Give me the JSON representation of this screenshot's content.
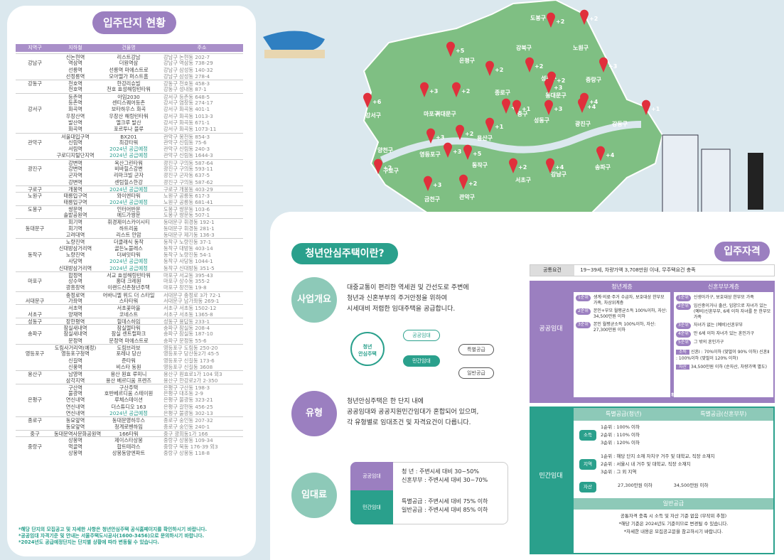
{
  "left": {
    "title": "입주단지 현황",
    "headers": [
      "지역구",
      "지하철",
      "건물명",
      "주소"
    ],
    "rows": [
      [
        "",
        "신논현역",
        "리스트강남",
        "강남구 논현동 202-7",
        1,
        0
      ],
      [
        "강남구",
        "역삼역",
        "더원역삼",
        "강남구 역삼동 738-29",
        0,
        0
      ],
      [
        "",
        "선릉역",
        "선릉역 마에스트로",
        "강남구 삼성동 140-32",
        0,
        0
      ],
      [
        "",
        "선정릉역",
        "모아엘가 퍼스트홈",
        "강남구 삼성동 278-4",
        0,
        0
      ],
      [
        "강동구",
        "천호역",
        "한강리슈빌",
        "강동구 천호동 458-3",
        1,
        0
      ],
      [
        "",
        "천호역",
        "천호 효성해링턴타워",
        "강동구 성내동 87-1",
        0,
        0
      ],
      [
        "",
        "등촌역",
        "아임2030",
        "강서구 등촌동 648-5",
        1,
        0
      ],
      [
        "",
        "등촌역",
        "센티스퀘어등촌",
        "강서구 염창동 274-17",
        0,
        0
      ],
      [
        "강서구",
        "화곡역",
        "보타하우스 화곡",
        "강서구 화곡동 401-1",
        0,
        0
      ],
      [
        "",
        "우장산역",
        "우장산 해링턴타워",
        "강서구 화곡동 1013-3",
        0,
        0
      ],
      [
        "",
        "발산역",
        "엘크루 발산",
        "강서구 화곡동 671-1",
        0,
        0
      ],
      [
        "",
        "화곡역",
        "포르투나 블루",
        "강서구 화곡동 1073-11",
        0,
        0
      ],
      [
        "",
        "서울대입구역",
        "BX201",
        "관악구 봉천동 854-3",
        1,
        0
      ],
      [
        "관악구",
        "신림역",
        "최강타워",
        "관악구 신림동 75-6",
        0,
        0
      ],
      [
        "",
        "서림역",
        "2024년 공급예정",
        "관악구 신림동 240-3",
        0,
        1
      ],
      [
        "",
        "구로디지털단지역",
        "2024년 공급예정",
        "관악구 신림동 1644-3",
        0,
        1
      ],
      [
        "",
        "강변역",
        "옥산그린타워",
        "광진구 구의동 587-64",
        1,
        0
      ],
      [
        "광진구",
        "강변역",
        "비바힐스강변",
        "광진구 구의동 593-11",
        0,
        0
      ],
      [
        "",
        "군자역",
        "리마크빌 군자",
        "광진구 군자동 637-5",
        0,
        0
      ],
      [
        "",
        "강변역",
        "센텀힐스한강",
        "광진구 구의동 587-62",
        0,
        0
      ],
      [
        "구로구",
        "개봉역",
        "2024년 공급예정",
        "구로구 개봉동 403-29",
        1,
        1
      ],
      [
        "노원구",
        "태릉입구역",
        "와이엔타워",
        "노원구 공릉동 617-3",
        1,
        0
      ],
      [
        "",
        "태릉입구역",
        "2024년 공급예정",
        "노원구 공릉동 681-41",
        0,
        1
      ],
      [
        "도봉구",
        "쌍문역",
        "인터어반문",
        "도봉구 쌍문동 103-6",
        1,
        0
      ],
      [
        "",
        "솔밭공원역",
        "에드가쌍문",
        "도봉구 쌍문동 507-1",
        0,
        0
      ],
      [
        "",
        "회기역",
        "휘경제이스카이시티",
        "동대문구 휘경동 192-1",
        1,
        0
      ],
      [
        "동대문구",
        "회기역",
        "하트리움",
        "동대문구 휘경동 281-1",
        0,
        0
      ],
      [
        "",
        "고려대역",
        "리스트 안암",
        "동대문구 제기동 136-3",
        0,
        0
      ],
      [
        "",
        "노량진역",
        "더클래식 동작",
        "동작구 노량진동 37-1",
        1,
        0
      ],
      [
        "",
        "신대방삼거리역",
        "골든노블레스",
        "동작구 대방동 403-14",
        0,
        0
      ],
      [
        "동작구",
        "노량진역",
        "더써밋타워",
        "동작구 노량진동 54-1",
        0,
        0
      ],
      [
        "",
        "사당역",
        "2024년 공급예정",
        "동작구 사당동 1044-1",
        0,
        1
      ],
      [
        "",
        "신대방삼거리역",
        "2024년 공급예정",
        "동작구 신대방동 351-5",
        0,
        1
      ],
      [
        "",
        "합정역",
        "서교 효성해링턴타워",
        "마포구 서교동 395-43",
        1,
        0
      ],
      [
        "마포구",
        "상수역",
        "홍대 크레원",
        "마포구 상수동 355-2",
        0,
        0
      ],
      [
        "",
        "광흥창역",
        "이랜드신촌청년주택",
        "마포구 창전동 19-8",
        0,
        0
      ],
      [
        "",
        "충정로역",
        "어바니엘 위드 더 스타일",
        "서대문구 충정로 3가 72-1",
        1,
        0
      ],
      [
        "서대문구",
        "가좌역",
        "스타타워",
        "서대문구 남가좌동 269-1",
        0,
        0
      ],
      [
        "",
        "서초역",
        "서초꽃마을",
        "서초구 서초동 1502-12",
        1,
        0
      ],
      [
        "서초구",
        "양재역",
        "코네스트",
        "서초구 서초동 1365-8",
        0,
        0
      ],
      [
        "성동구",
        "장한평역",
        "힐데스하임",
        "성동구 용답동 233-1",
        1,
        0
      ],
      [
        "",
        "잠실새내역",
        "잠실엘타워",
        "송파구 잠실동 208-4",
        1,
        0
      ],
      [
        "송파구",
        "잠실새내역",
        "잠실 센트럴파크",
        "송파구 잠실동 187-10",
        0,
        0
      ],
      [
        "",
        "문정역",
        "문정역 마에스트로",
        "송파구 문정동 55-6",
        0,
        0
      ],
      [
        "",
        "도림사거리역(예정)",
        "도림브라보",
        "영등포구 도림동 250-20",
        1,
        0
      ],
      [
        "영등포구",
        "영등포구청역",
        "포레나 당산",
        "영등포구 당산동2가 45-5",
        0,
        0
      ],
      [
        "",
        "신길역",
        "준타워",
        "영등포구 신길동 173-6",
        0,
        0
      ],
      [
        "",
        "신풍역",
        "비스타 동원",
        "영등포구 신길동 3608",
        0,
        0
      ],
      [
        "용산구",
        "남영역",
        "용산 원효 루미니",
        "용산구 원효로1가 104 외3",
        1,
        0
      ],
      [
        "",
        "삼각지역",
        "용산 베르디움 프렌즈",
        "용산구 한강로2가 2-350",
        0,
        0
      ],
      [
        "",
        "구산역",
        "구산주택",
        "은평구 구산동 198-3",
        1,
        0
      ],
      [
        "",
        "불광역",
        "호반베르디움 스테이원",
        "은평구 대조동 2-9",
        0,
        0
      ],
      [
        "은평구",
        "연신내역",
        "루체스테이션",
        "은평구 불광동 323-21",
        0,
        0
      ],
      [
        "",
        "연신내역",
        "더스튜디오 163",
        "은평구 갈현동 456-25",
        0,
        0
      ],
      [
        "",
        "연신내역",
        "2024년 공급예정",
        "은평구 불광동 302-13",
        0,
        1
      ],
      [
        "종로구",
        "동묘앞역",
        "동대문영하우스",
        "종로구 숭인동 207-32",
        1,
        0
      ],
      [
        "",
        "동묘앞역",
        "청계로벤하임",
        "종로구 숭인동 240-1",
        0,
        0
      ],
      [
        "중구",
        "동대문역사문화공원역",
        "166타워",
        "중구 광희동1가 166",
        1,
        0
      ],
      [
        "",
        "상봉역",
        "제이스타상봉",
        "중랑구 상봉동 109-34",
        1,
        0
      ],
      [
        "중랑구",
        "먹골역",
        "합트테라스",
        "중랑구 묵동 176-39 외3",
        0,
        0
      ],
      [
        "",
        "상봉역",
        "상봉동양엔파트",
        "중랑구 상봉동 118-8",
        0,
        0
      ]
    ],
    "notes": [
      "*해당 단지의 모집공고 및 자세한 사항은 청년안심주택 공식홈페이지를 확인하시기 바랍니다.",
      "*공공임대 자격기준 및 안내는 서울주택도시공사(1600-3456)으로 문의하시기 바랍니다.",
      "*2024년도 공급예정단지는 단지별 상황에 따라 변동될 수 있습니다."
    ]
  },
  "map": {
    "districts": [
      [
        "도봉구",
        ",.,"
      ],
      [
        "강북구",
        ""
      ],
      [
        "노원구",
        ""
      ],
      [
        "은평구",
        ""
      ],
      [
        "성북구",
        ""
      ],
      [
        "중랑구",
        ""
      ],
      [
        "종로구",
        ""
      ],
      [
        "동대문구",
        ""
      ],
      [
        "서대문구",
        ""
      ],
      [
        "마포구",
        ""
      ],
      [
        "중구",
        ""
      ],
      [
        "성동구",
        ""
      ],
      [
        "광진구",
        ""
      ],
      [
        "강서구",
        ""
      ],
      [
        "용산구",
        ""
      ],
      [
        "강동구",
        ""
      ],
      [
        "양천구",
        ""
      ],
      [
        "영등포구",
        ""
      ],
      [
        "동작구",
        ""
      ],
      [
        "구로구",
        ""
      ],
      [
        "서초구",
        ""
      ],
      [
        "강남구",
        ""
      ],
      [
        "송파구",
        ""
      ],
      [
        "금천구",
        ""
      ],
      [
        "관악구",
        ""
      ]
    ],
    "counts": [
      "+2",
      "+2",
      "+5",
      "+2",
      "+2",
      "+3",
      "+3",
      "+2",
      "+6",
      "+2",
      "+3",
      "+1",
      "+3",
      "+4",
      "+2",
      "+1",
      "+3",
      "+1",
      "+3",
      "+4",
      "+5",
      "+2",
      "+2",
      "+4",
      "+3",
      "+2",
      "+4",
      "+1"
    ]
  },
  "intro": {
    "title": "청년안심주택이란?",
    "s1": {
      "label": "사업개요",
      "lines": [
        "대중교통이 편리한 역세권 및 간선도로 주변에",
        "청년과 신혼부부의 주거안정을 위하여",
        "시세대비 저렴한 임대주택을 공급합니다."
      ]
    },
    "diagram": {
      "center": "청년\n안심주택",
      "public": "공공임대",
      "private": "민간임대",
      "special": "특별공급",
      "general": "일반공급"
    },
    "s2": {
      "label": "유형",
      "lines": [
        "청년안심주택은 한 단지 내에",
        "공공임대와 공공지원민간임대가 혼합되어 있으며,",
        "각 유형별로 임대조건 및 자격요건이 다릅니다."
      ]
    },
    "s3": {
      "label": "임대료",
      "public": "공공임대",
      "private": "민간임대",
      "pub1": "청      년 : 주변시세 대비 30~50%",
      "pub2": "신혼부부 : 주변시세 대비 30~70%",
      "pri1": "특별공급 : 주변시세 대비 75% 이하",
      "pri2": "일반공급 : 주변시세 대비 85% 이하"
    }
  },
  "qual": {
    "title": "입주자격",
    "common_label": "공통요건",
    "common": "19~39세, 차량가액 3,708만원 이내, 무주택요건 충족",
    "public_label": "공공임대",
    "youth": "청년계층",
    "couple": "신혼부부계층",
    "y": [
      [
        "1순위",
        "생계·의료·주거 수급자, 보호대상 한부모 가족, 차상위계층"
      ],
      [
        "2순위",
        "본인+부모 월평균소득 100%이하, 자산: 34,500만원 이하"
      ],
      [
        "3순위",
        "본인 월평균소득 100%이하, 자산: 27,300만원 이하"
      ]
    ],
    "c": [
      [
        "1순위",
        "신생아가구, 보호대상 한부모 가족"
      ],
      [
        "2순위",
        "임신중이거나 출산, 입양으로 자녀가 있는 (예비)신혼부부, 6세 이하 자녀를 둔 한부모 가족"
      ],
      [
        "3순위",
        "자녀가 없는 (예비)신혼부부"
      ],
      [
        "4순위",
        "만 6세 이하 자녀가 있는 혼인가구"
      ],
      [
        "5순위",
        "그 밖의 혼인가구"
      ]
    ],
    "inc_label": "소득",
    "inc": "신혼Ⅰ : 70%이하 (맞벌이 90% 이하)  신혼Ⅱ : 100%이하 (맞벌이 120% 이하)",
    "asset_label": "자산",
    "asset": "34,500만원 이하 (순자산, 차량가액 별도)",
    "pub_note": "*그 외 순위, 가점 등 의 자세한 사항은 모집공고를 확인하시기 바랍니다.",
    "private_label": "민간임대",
    "sp_youth": "특별공급(청년)",
    "sp_couple": "특별공급(신혼부부)",
    "income": "소득",
    "region": "지역",
    "assets": "자산",
    "ranks": [
      "1순위 : 100% 이하",
      "2순위 : 110% 이하",
      "3순위 : 120% 이하"
    ],
    "regions": [
      "1순위 : 해당 단지 소재 자치구 거주 및 대학교, 직장 소재지",
      "2순위 : 서울시 내 거주 및 대학교, 직장 소재지",
      "3순위 : 그 외 지역"
    ],
    "asset_y": "27,300만원 이하",
    "asset_c": "34,500만원 이하",
    "general": "일반공급",
    "gen1": "공통자격 충족 시 소득 및 자산 기준 없음 (무작위 추첨)",
    "gen2": "*해당 기준은 2024년도 기준이므로 변경될 수 있습니다.",
    "gen3": "*자세한 내용은 모집공고문을 참고하시기 바랍니다."
  }
}
